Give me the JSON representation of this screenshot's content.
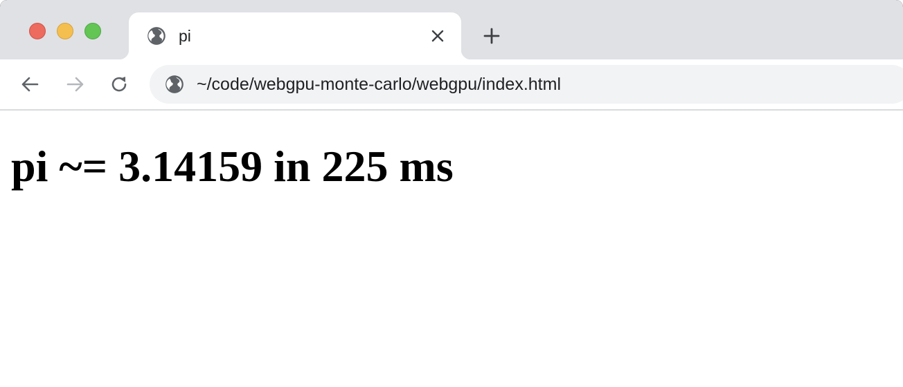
{
  "browser": {
    "tab": {
      "title": "pi",
      "favicon": "globe-icon"
    },
    "new_tab_icon": "plus-icon",
    "toolbar": {
      "back_icon": "arrow-left-icon",
      "forward_icon": "arrow-right-icon",
      "reload_icon": "reload-icon",
      "site_icon": "globe-icon",
      "url": "~/code/webgpu-monte-carlo/webgpu/index.html"
    },
    "traffic_lights": {
      "close_color": "#ed6a5e",
      "minimize_color": "#f5bf4f",
      "maximize_color": "#62c554"
    }
  },
  "page": {
    "heading": "pi ~= 3.14159 in 225 ms"
  }
}
